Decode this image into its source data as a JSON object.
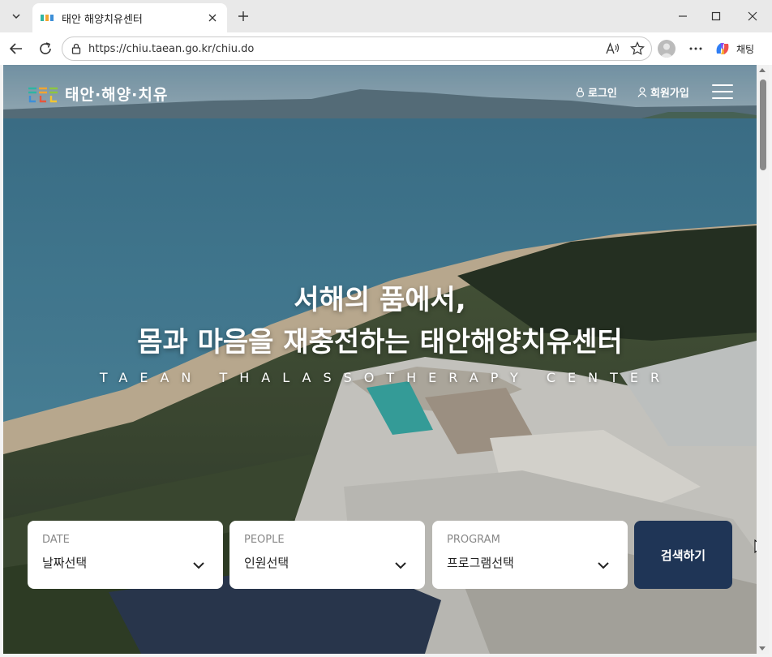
{
  "browser": {
    "tab_title": "태안 해양치유센터",
    "url": "https://chiu.taean.go.kr/chiu.do",
    "chat_label": "채팅"
  },
  "site": {
    "logo_text": "태안·해양·치유",
    "login": "로그인",
    "signup": "회원가입"
  },
  "hero": {
    "title_line1": "서해의 품에서,",
    "title_line2": "몸과 마음을 재충전하는 태안해양치유센터",
    "subtitle": "TAEAN THALASSOTHERAPY CENTER"
  },
  "search": {
    "date_label": "DATE",
    "date_value": "날짜선택",
    "people_label": "PEOPLE",
    "people_value": "인원선택",
    "program_label": "PROGRAM",
    "program_value": "프로그램선택",
    "button": "검색하기"
  },
  "colors": {
    "search_button": "#1f3556",
    "card": "#ffffff"
  }
}
